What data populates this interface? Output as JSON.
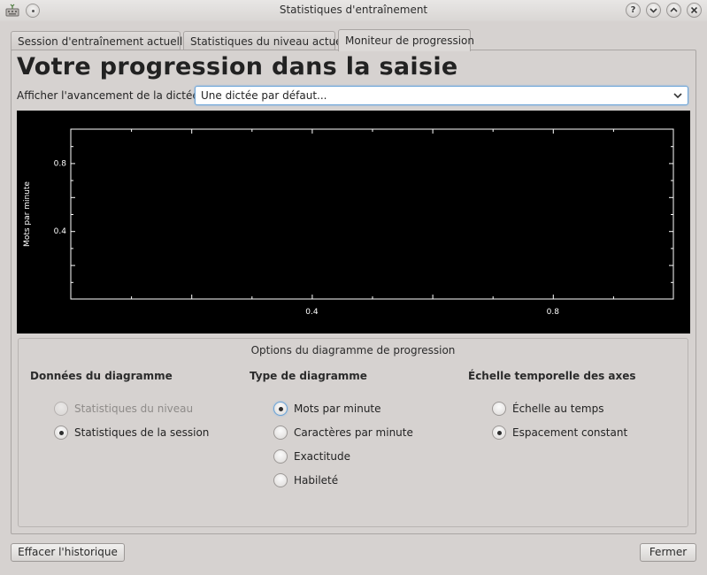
{
  "window": {
    "title": "Statistiques d'entraînement"
  },
  "tabs": [
    {
      "label": "Session d'entraînement actuelle",
      "active": false
    },
    {
      "label": "Statistiques du niveau actuel",
      "active": false
    },
    {
      "label": "Moniteur de progression",
      "active": true
    }
  ],
  "page": {
    "heading": "Votre progression dans la saisie",
    "selector_label": "Afficher l'avancement de la dictée :",
    "selector_value": "Une dictée par défaut..."
  },
  "chart_data": {
    "type": "line",
    "title": "",
    "xlabel": "",
    "ylabel": "Mots par minute",
    "xlim": [
      0,
      1
    ],
    "ylim": [
      0,
      1
    ],
    "xtick_labels": [
      "0.4",
      "0.8"
    ],
    "ytick_labels": [
      "0.8",
      "0.4"
    ],
    "series": [],
    "background": "#000000",
    "foreground": "#ffffff"
  },
  "options": {
    "title": "Options du diagramme de progression",
    "columns": [
      {
        "header": "Données du diagramme",
        "items": [
          {
            "label": "Statistiques du niveau",
            "checked": false,
            "disabled": true
          },
          {
            "label": "Statistiques de la session",
            "checked": true,
            "disabled": false
          }
        ]
      },
      {
        "header": "Type de diagramme",
        "items": [
          {
            "label": "Mots par minute",
            "checked": true,
            "disabled": false
          },
          {
            "label": "Caractères par minute",
            "checked": false,
            "disabled": false
          },
          {
            "label": "Exactitude",
            "checked": false,
            "disabled": false
          },
          {
            "label": "Habileté",
            "checked": false,
            "disabled": false
          }
        ]
      },
      {
        "header": "Échelle temporelle des axes",
        "items": [
          {
            "label": "Échelle au temps",
            "checked": false,
            "disabled": false
          },
          {
            "label": "Espacement constant",
            "checked": true,
            "disabled": false
          }
        ]
      }
    ]
  },
  "buttons": {
    "clear_history": "Effacer l'historique",
    "close": "Fermer"
  },
  "icons": {
    "app": "keyboard-app-icon",
    "pin": "pin-icon",
    "help": "help-icon",
    "minimize": "minimize-icon",
    "maximize": "maximize-icon",
    "close": "close-icon"
  },
  "colors": {
    "accent": "#6aa3d6",
    "window_bg": "#d6d2d0"
  }
}
